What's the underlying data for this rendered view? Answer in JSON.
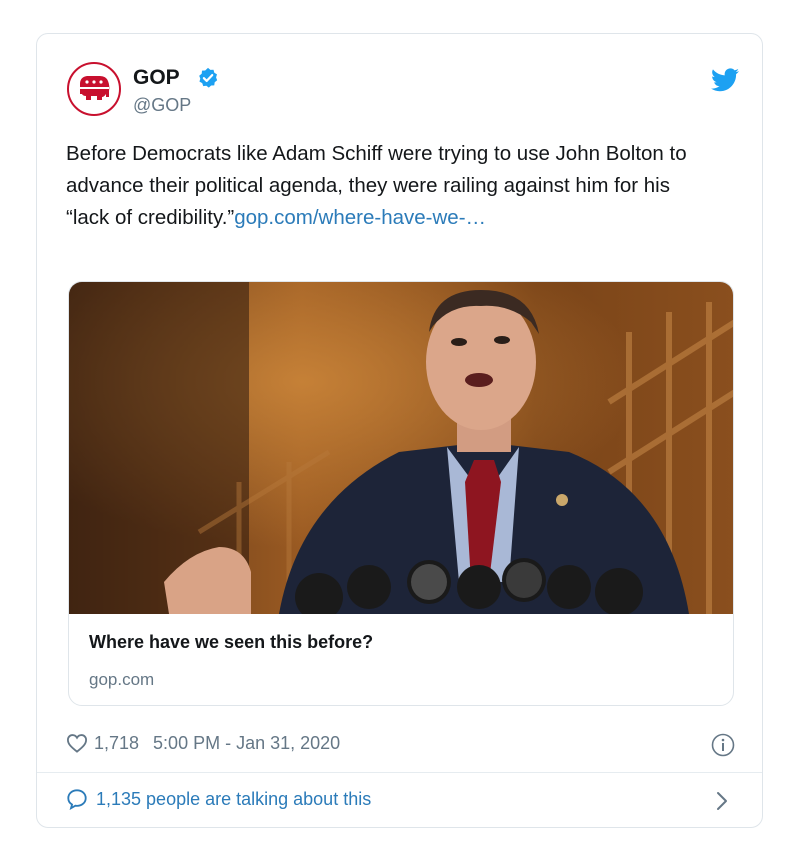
{
  "tweet": {
    "author_name": "GOP",
    "handle": "@GOP",
    "text": "Before Democrats like Adam Schiff were trying to use John Bolton to advance their political agenda, they were railing against him for his “lack of credibility.”",
    "link_text": "gop.com/where-have-we-…",
    "card_title": "Where have we seen this before?",
    "card_domain": "gop.com",
    "likes": "1,718",
    "timestamp": "5:00 PM - Jan 31, 2020",
    "talking": "1,135 people are talking about this"
  },
  "colors": {
    "link": "#2b7bb9",
    "muted": "#657786",
    "gop_red": "#c8102e",
    "twitter_blue": "#1da1f2"
  },
  "icons": [
    "gop-elephant-logo",
    "verified-badge-icon",
    "twitter-bird-icon",
    "heart-icon",
    "info-icon",
    "speech-bubble-icon",
    "chevron-right-icon"
  ]
}
